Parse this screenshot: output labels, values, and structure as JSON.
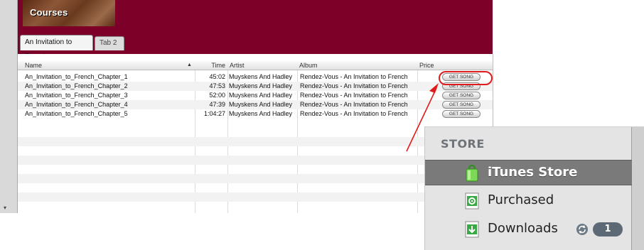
{
  "banner": {
    "title": "Courses"
  },
  "tabs": [
    {
      "label": "An Invitation to French"
    },
    {
      "label": "Tab 2"
    }
  ],
  "table": {
    "columns": [
      "Name",
      "Time",
      "Artist",
      "Album",
      "Price"
    ],
    "sort_indicator": "▲",
    "rows": [
      {
        "name": "An_Invitation_to_French_Chapter_1",
        "time": "45:02",
        "artist": "Muyskens And Hadley",
        "album": "Rendez-Vous - An Invitation to French",
        "price_button": "GET SONG"
      },
      {
        "name": "An_Invitation_to_French_Chapter_2",
        "time": "47:53",
        "artist": "Muyskens And Hadley",
        "album": "Rendez-Vous - An Invitation to French",
        "price_button": "GET SONG"
      },
      {
        "name": "An_Invitation_to_French_Chapter_3",
        "time": "52:00",
        "artist": "Muyskens And Hadley",
        "album": "Rendez-Vous - An Invitation to French",
        "price_button": "GET SONG"
      },
      {
        "name": "An_Invitation_to_French_Chapter_4",
        "time": "47:39",
        "artist": "Muyskens And Hadley",
        "album": "Rendez-Vous - An Invitation to French",
        "price_button": "GET SONG"
      },
      {
        "name": "An_Invitation_to_French_Chapter_5",
        "time": "1:04:27",
        "artist": "Muyskens And Hadley",
        "album": "Rendez-Vous - An Invitation to French",
        "price_button": "GET SONG"
      }
    ]
  },
  "sidebar": {
    "heading": "STORE",
    "items": [
      {
        "label": "iTunes Store",
        "icon": "shopping-bag-icon",
        "selected": true
      },
      {
        "label": "Purchased",
        "icon": "gear-document-icon",
        "selected": false
      },
      {
        "label": "Downloads",
        "icon": "download-arrow-icon",
        "selected": false,
        "sync_icon": "sync-icon",
        "badge": "1"
      }
    ]
  },
  "colors": {
    "banner": "#7c0027",
    "annotation": "#e11b1b",
    "sidebar_selected": "#7a7a7a",
    "badge": "#5d6a76"
  }
}
